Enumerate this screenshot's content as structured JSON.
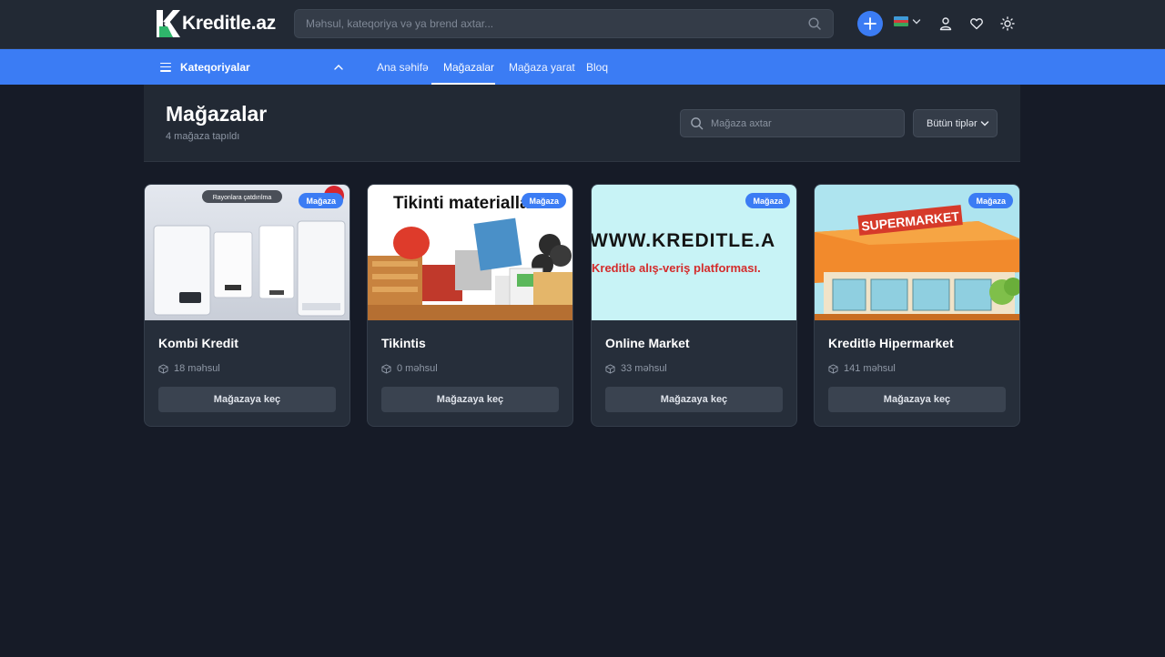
{
  "header": {
    "logo_text": "Kreditle.az",
    "search_placeholder": "Məhsul, kateqoriya və ya brend axtar...",
    "icons": [
      "search-icon",
      "plus-icon",
      "flag-az-icon",
      "chevron-down-icon",
      "user-icon",
      "heart-icon",
      "sun-icon"
    ]
  },
  "nav": {
    "categories_label": "Kateqoriyalar",
    "links": [
      {
        "label": "Ana səhifə",
        "active": false
      },
      {
        "label": "Mağazalar",
        "active": true
      },
      {
        "label": "Mağaza yarat",
        "active": false
      },
      {
        "label": "Bloq",
        "active": false
      }
    ]
  },
  "page": {
    "title": "Mağazalar",
    "count_text": "4 mağaza tapıldı",
    "search_placeholder": "Mağaza axtar",
    "type_filter": "Bütün tiplər"
  },
  "stores": [
    {
      "name": "Kombi Kredit",
      "products": "18 məhsul",
      "badge": "Mağaza",
      "button": "Mağazaya keç",
      "image_text": "Rayonlara çatdırılma"
    },
    {
      "name": "Tikintis",
      "products": "0 məhsul",
      "badge": "Mağaza",
      "button": "Mağazaya keç",
      "image_text": "Tikinti materialla"
    },
    {
      "name": "Online Market",
      "products": "33 məhsul",
      "badge": "Mağaza",
      "button": "Mağazaya keç",
      "image_text": "WWW.KREDITLE.A",
      "image_text_2": "Kreditlə alış-veriş platforması."
    },
    {
      "name": "Kreditlə Hipermarket",
      "products": "141 məhsul",
      "badge": "Mağaza",
      "button": "Mağazaya keç",
      "image_text": "SUPERMARKET"
    }
  ],
  "colors": {
    "background": "#161b27",
    "header": "#222934",
    "accent": "#3b7cf4",
    "card": "#262e3a",
    "button": "#3a4350"
  }
}
